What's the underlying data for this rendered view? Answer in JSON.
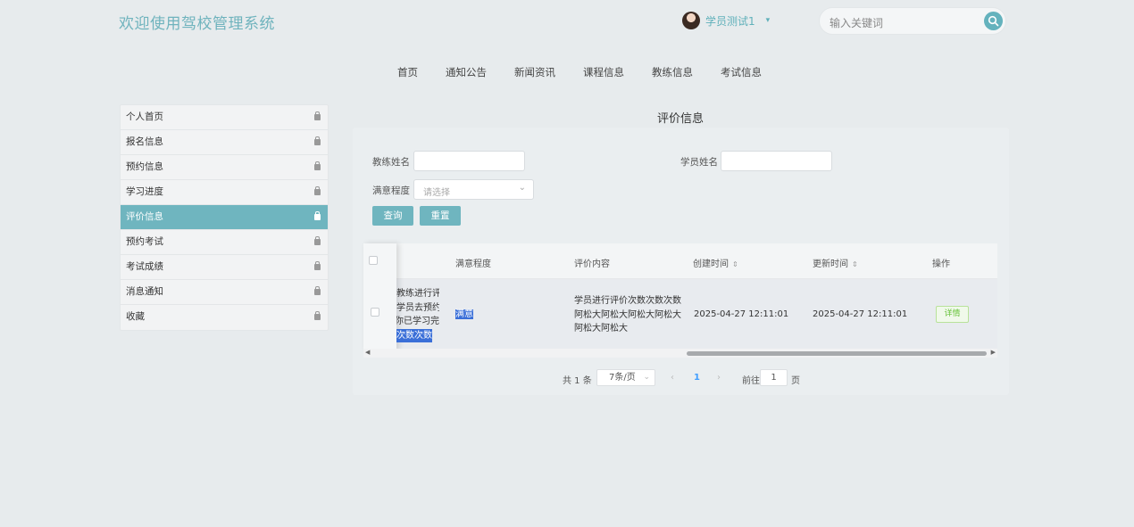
{
  "header": {
    "site_title": "欢迎使用驾校管理系统",
    "user_name": "学员测试1",
    "search_placeholder": "输入关键词"
  },
  "nav": [
    "首页",
    "通知公告",
    "新闻资讯",
    "课程信息",
    "教练信息",
    "考试信息"
  ],
  "sidebar": {
    "items": [
      {
        "label": "个人首页",
        "active": false
      },
      {
        "label": "报名信息",
        "active": false
      },
      {
        "label": "预约信息",
        "active": false
      },
      {
        "label": "学习进度",
        "active": false
      },
      {
        "label": "评价信息",
        "active": true
      },
      {
        "label": "预约考试",
        "active": false
      },
      {
        "label": "考试成绩",
        "active": false
      },
      {
        "label": "消息通知",
        "active": false
      },
      {
        "label": "收藏",
        "active": false
      }
    ]
  },
  "main": {
    "title": "评价信息",
    "filters": {
      "coach_label": "教练姓名",
      "student_label": "学员姓名",
      "satisfaction_label": "满意程度",
      "satisfaction_placeholder": "请选择",
      "query_button": "查询",
      "reset_button": "重置"
    },
    "table": {
      "headers": {
        "satisfaction": "满意程度",
        "content": "评价内容",
        "created": "创建时间",
        "updated": "更新时间",
        "action": "操作"
      },
      "rows": [
        {
          "clipped_lines": [
            "教练进行评",
            "学员去预约",
            "你已学习完",
            "次数次数"
          ],
          "satisfaction": "满意",
          "content_lines": [
            "学员进行评价次数次数次数",
            "阿松大阿松大阿松大阿松大",
            "阿松大阿松大"
          ],
          "created": "2025-04-27 12:11:01",
          "updated": "2025-04-27 12:11:01",
          "action": "详情"
        }
      ]
    },
    "pagination": {
      "total": "共 1 条",
      "page_size": "7条/页",
      "current_page": "1",
      "goto_label": "前往",
      "goto_value": "1",
      "page_suffix": "页"
    }
  }
}
